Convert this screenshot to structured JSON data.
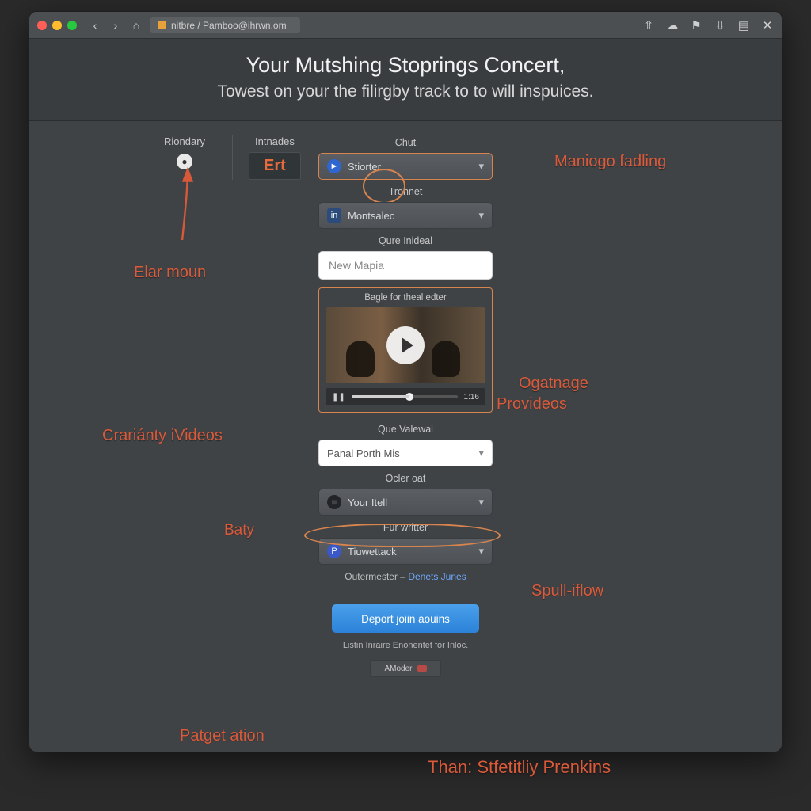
{
  "url": "nitbre / Pamboo@ihrwn.om",
  "header": {
    "title": "Your Mutshing Stoprings Concert,",
    "subtitle": "Towest on your the filirgby track to to will inspuices."
  },
  "topRow": {
    "col1": "Riondary",
    "col2": "Intnades",
    "ert": "Ert"
  },
  "fields": {
    "chut": {
      "label": "Chut",
      "value": "Stiorter"
    },
    "renner": {
      "label": "Tronnet",
      "value": "Montsalec"
    },
    "qure": {
      "label": "Qure Inideal",
      "placeholder": "New Mapia"
    },
    "video": {
      "caption": "Bagle for theal edter",
      "duration": "1:16"
    },
    "quev": {
      "label": "Que Valewal",
      "value": "Panal Porth Mis"
    },
    "ocler": {
      "label": "Ocler oat",
      "value": "Your Itell"
    },
    "fur": {
      "label": "Fur writter",
      "value": "Tiuwettack"
    }
  },
  "links": {
    "left": "Outermester",
    "right": "Denets Junes"
  },
  "cta": "Deport joiin aouins",
  "fine": "Listin Inraire Enonentet for Inloc.",
  "chip": "AModer",
  "annotations": {
    "elar": "Elar moun",
    "manigo": "Maniogo fadling",
    "crar": "Crariánty iVideos",
    "ogat1": "Ogatnage",
    "ogat2": "Provideos",
    "baty": "Baty",
    "spull": "Spull-iflow",
    "patget": "Patget ation",
    "than": "Than: Stfetitliy Prenkins"
  }
}
